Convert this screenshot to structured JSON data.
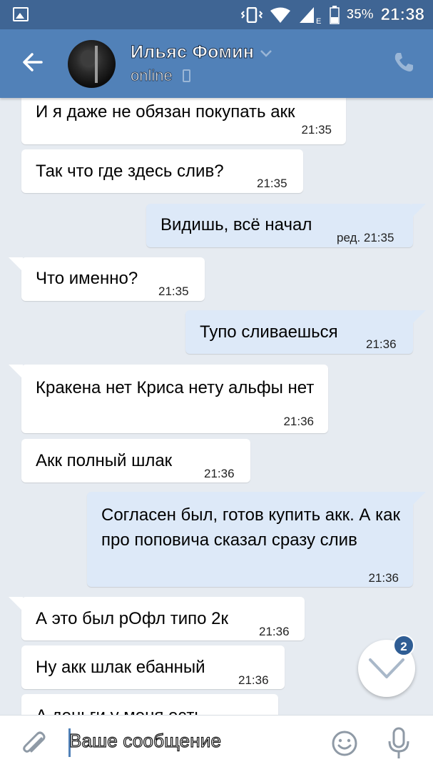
{
  "status_bar": {
    "battery": "35%",
    "time": "21:38",
    "network": "E"
  },
  "header": {
    "name": "Ильяс Фомин",
    "status": "online"
  },
  "messages": [
    {
      "dir": "in",
      "text": "И я даже не обязан покупать акк",
      "time": "21:35"
    },
    {
      "dir": "in",
      "text": "Так что где здесь слив?",
      "time": "21:35"
    },
    {
      "dir": "out",
      "text": "Видишь, всё начал",
      "time": "ред. 21:35"
    },
    {
      "dir": "in",
      "text": "Что именно?",
      "time": "21:35"
    },
    {
      "dir": "out",
      "text": "Тупо сливаешься",
      "time": "21:36"
    },
    {
      "dir": "in",
      "text": "Кракена нет Криса нету альфы нет",
      "time": "21:36"
    },
    {
      "dir": "in",
      "text": "Акк полный шлак",
      "time": "21:36"
    },
    {
      "dir": "out",
      "text": "Согласен был, готов купить акк. А как про поповича сказал сразу слив",
      "time": "21:36"
    },
    {
      "dir": "in",
      "text": "А это был рОфл типо 2к",
      "time": "21:36"
    },
    {
      "dir": "in",
      "text": "Ну акк шлак ебанный",
      "time": "21:36"
    },
    {
      "dir": "in",
      "text": "А деньги у меня есть",
      "time": ""
    }
  ],
  "scroll_button": {
    "unread": "2"
  },
  "composer": {
    "placeholder": "Ваше сообщение"
  },
  "colors": {
    "header": "#5181b8",
    "status_bar": "#3f6594",
    "outgoing": "#dde9f8",
    "incoming": "#ffffff",
    "background": "#e6ebf1"
  }
}
